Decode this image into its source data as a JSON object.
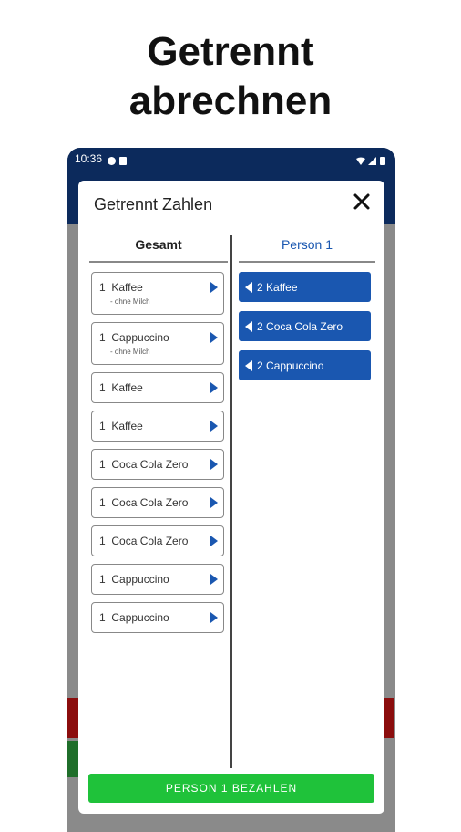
{
  "headline": {
    "line1": "Getrennt",
    "line2": "abrechnen"
  },
  "statusbar": {
    "time": "10:36"
  },
  "dialog": {
    "title": "Getrennt Zahlen",
    "left_header": "Gesamt",
    "right_header": "Person 1",
    "left_items": [
      {
        "qty": "1",
        "name": "Kaffee",
        "modifier": "- ohne Milch"
      },
      {
        "qty": "1",
        "name": "Cappuccino",
        "modifier": "- ohne Milch"
      },
      {
        "qty": "1",
        "name": "Kaffee",
        "modifier": ""
      },
      {
        "qty": "1",
        "name": "Kaffee",
        "modifier": ""
      },
      {
        "qty": "1",
        "name": "Coca Cola Zero",
        "modifier": ""
      },
      {
        "qty": "1",
        "name": "Coca Cola Zero",
        "modifier": ""
      },
      {
        "qty": "1",
        "name": "Coca Cola Zero",
        "modifier": ""
      },
      {
        "qty": "1",
        "name": "Cappuccino",
        "modifier": ""
      },
      {
        "qty": "1",
        "name": "Cappuccino",
        "modifier": ""
      }
    ],
    "right_items": [
      {
        "qty": "2",
        "name": "Kaffee"
      },
      {
        "qty": "2",
        "name": "Coca Cola Zero"
      },
      {
        "qty": "2",
        "name": "Cappuccino"
      }
    ],
    "pay_button": "PERSON 1 BEZAHLEN"
  },
  "colors": {
    "accent": "#1a57b0",
    "pay": "#1fc23a",
    "appbar": "#0c2a5c"
  }
}
